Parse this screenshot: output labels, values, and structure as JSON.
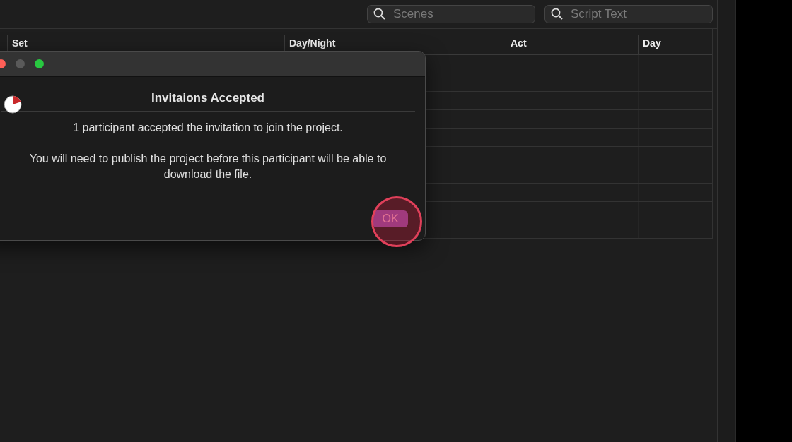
{
  "toolbar": {
    "searches": [
      {
        "placeholder": "Scenes"
      },
      {
        "placeholder": "Script Text"
      }
    ]
  },
  "table": {
    "columns": [
      "Set",
      "Day/Night",
      "Act",
      "Day"
    ]
  },
  "dialog": {
    "title": "Invitaions Accepted",
    "messages": [
      "1 participant accepted the invitation to join the project.",
      "You will need to publish the project before this participant will be able to download the file."
    ],
    "button": "OK",
    "highlighted": true
  }
}
